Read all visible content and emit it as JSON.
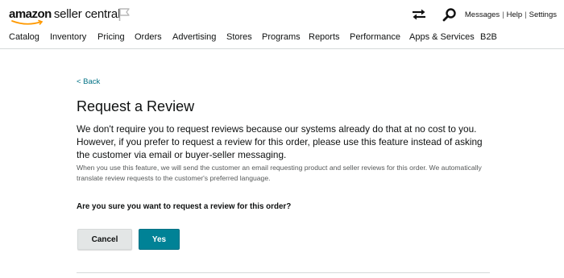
{
  "header": {
    "logo_brand": "amazon",
    "logo_suffix": "seller central",
    "links": [
      "Messages",
      "Help",
      "Settings"
    ]
  },
  "nav": {
    "items": [
      "Catalog",
      "Inventory",
      "Pricing",
      "Orders",
      "Advertising",
      "Stores",
      "Programs",
      "Reports",
      "Performance",
      "Apps & Services",
      "B2B"
    ]
  },
  "content": {
    "back_label": "< Back",
    "title": "Request a Review",
    "main_text": "We don't require you to request reviews because our systems already do that at no cost to you. However, if you prefer to request a review for this order, please use this feature instead of asking the customer via email or buyer-seller messaging.",
    "note_text": "When you use this feature, we will send the customer an email requesting product and seller reviews for this order. We automatically translate review requests to the customer's preferred language.",
    "question": "Are you sure you want to request a review for this order?",
    "cancel_label": "Cancel",
    "yes_label": "Yes"
  },
  "colors": {
    "accent": "#008296",
    "link": "#007185",
    "logo_smile": "#ff9900"
  },
  "icons": [
    "flag-icon",
    "swap-icon",
    "search-icon"
  ]
}
